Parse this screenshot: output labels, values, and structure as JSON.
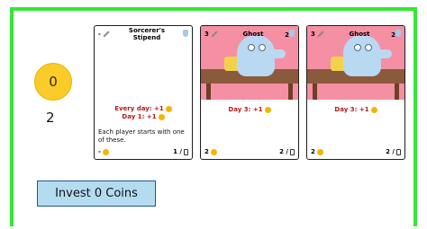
{
  "coin_display": {
    "value": "0"
  },
  "player_count": "2",
  "cards": [
    {
      "title": "Sorcerer's Stipend",
      "cost": "-",
      "red_line_1": "Every day: +1",
      "red_line_2": "Day 1: +1",
      "description": "Each player starts with one of these.",
      "footer_left": "-",
      "footer_right": "1 /"
    },
    {
      "title": "Ghost",
      "cost": "3",
      "cost_gem": "2",
      "red_line_1": "Day 3: +1",
      "footer_left": "2",
      "footer_right": "2 /"
    },
    {
      "title": "Ghost",
      "cost": "3",
      "cost_gem": "2",
      "red_line_1": "Day 3: +1",
      "footer_left": "2",
      "footer_right": "2 /"
    }
  ],
  "invest_button": {
    "label": "Invest 0 Coins"
  },
  "colors": {
    "frame": "#33e833",
    "coin": "#f9cc2a",
    "button_bg": "#b3dcf0",
    "button_border": "#20558f",
    "red_text": "#b31b1b"
  },
  "icons": [
    "coin-icon",
    "wand-icon",
    "gem-icon",
    "bottle-icon",
    "ghost-art"
  ]
}
